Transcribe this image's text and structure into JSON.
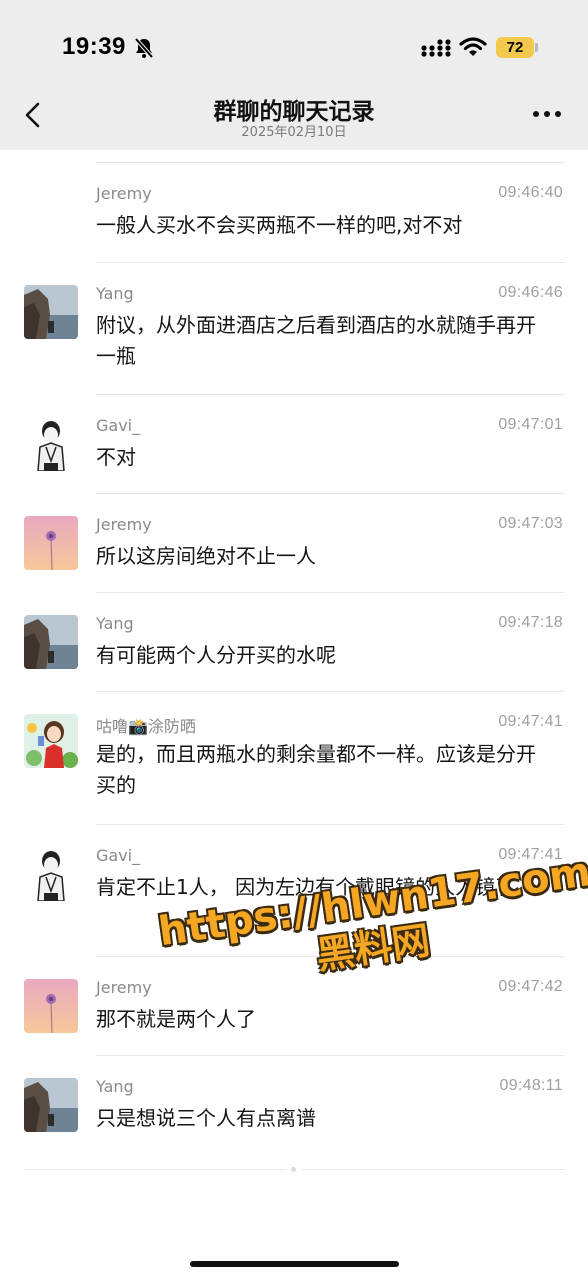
{
  "status_bar": {
    "time": "19:39",
    "battery": "72"
  },
  "header": {
    "title": "群聊的聊天记录",
    "date": "2025年02月10日"
  },
  "messages": [
    {
      "name": "Jeremy",
      "time": "09:46:40",
      "text": "一般人买水不会买两瓶不一样的吧,对不对",
      "avatar": "none"
    },
    {
      "name": "Yang",
      "time": "09:46:46",
      "text": "附议，从外面进酒店之后看到酒店的水就随手再开一瓶",
      "avatar": "coast-photo-avatar"
    },
    {
      "name": "Gavi_",
      "time": "09:47:01",
      "text": "不对",
      "avatar": "man-sketch-avatar"
    },
    {
      "name": "Jeremy",
      "time": "09:47:03",
      "text": "所以这房间绝对不止一人",
      "avatar": "flower-gradient-avatar"
    },
    {
      "name": "Yang",
      "time": "09:47:18",
      "text": "有可能两个人分开买的水呢",
      "avatar": "coast-photo-avatar"
    },
    {
      "name": "咕噜📸涂防晒",
      "time": "09:47:41",
      "text": "是的，而且两瓶水的剩余量都不一样。应该是分开买的",
      "avatar": "cartoon-girl-avatar"
    },
    {
      "name": "Gavi_",
      "time": "09:47:41",
      "text": "肯定不止1人， 因为左边有个戴眼镜的人入镜了",
      "avatar": "man-sketch-avatar"
    },
    {
      "name": "Jeremy",
      "time": "09:47:42",
      "text": "那不就是两个人了",
      "avatar": "flower-gradient-avatar"
    },
    {
      "name": "Yang",
      "time": "09:48:11",
      "text": "只是想说三个人有点离谱",
      "avatar": "coast-photo-avatar"
    }
  ],
  "watermark": {
    "line1": "https://hlwn17.com",
    "line2": "黑料网"
  },
  "colors": {
    "header_bg": "#ededed",
    "battery": "#f2c94c",
    "watermark": "#f5a623"
  }
}
